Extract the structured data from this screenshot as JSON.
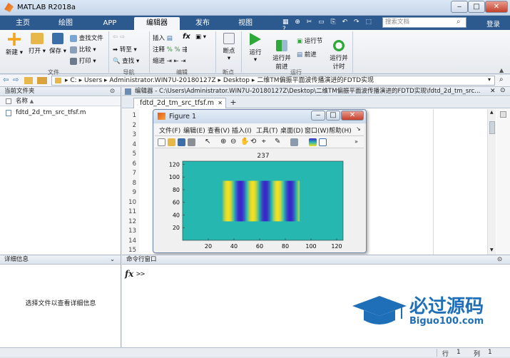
{
  "window": {
    "title": "MATLAB R2018a"
  },
  "tabs": [
    {
      "label": "主页",
      "active": false
    },
    {
      "label": "绘图",
      "active": false
    },
    {
      "label": "APP",
      "active": false
    },
    {
      "label": "编辑器",
      "active": true
    },
    {
      "label": "发布",
      "active": false
    },
    {
      "label": "视图",
      "active": false
    }
  ],
  "search": {
    "placeholder": "搜索文档",
    "login": "登录"
  },
  "toolstrip": {
    "file": {
      "new": "新建",
      "open": "打开",
      "save": "保存",
      "find_files": "查找文件",
      "compare": "比较",
      "print": "打印",
      "group": "文件"
    },
    "nav": {
      "goto": "转至",
      "find": "查找",
      "group": "导航"
    },
    "edit": {
      "insert": "插入",
      "comment": "注释",
      "indent": "缩进",
      "fx": "fx",
      "group": "编辑"
    },
    "breakpoints": {
      "label": "断点",
      "group": "断点"
    },
    "run": {
      "run": "运行",
      "run_advance": "运行并\n前进",
      "run_section": "运行节",
      "advance": "前进",
      "run_time": "运行并\n计时",
      "group": "运行"
    }
  },
  "address": {
    "parts": [
      "C:",
      "Users",
      "Administrator.WIN7U-20180127Z",
      "Desktop",
      "二维TM偏振平面波传播演进的FDTD实现"
    ]
  },
  "current_folder": {
    "title": "当前文件夹",
    "col_name": "名称",
    "col_sort": "▲",
    "files": [
      "fdtd_2d_tm_src_tfsf.m"
    ]
  },
  "details": {
    "title": "详细信息",
    "empty_msg": "选择文件以查看详细信息"
  },
  "editor": {
    "title": "编辑器 - C:\\Users\\Administrator.WIN7U-20180127Z\\Desktop\\二维TM偏振平面波传播演进的FDTD实现\\fdtd_2d_tm_src...",
    "tab": "fdtd_2d_tm_src_tfsf.m",
    "lines": [
      "1",
      "2",
      "3",
      "4",
      "5",
      "6",
      "7",
      "8",
      "9",
      "10",
      "11",
      "12",
      "13",
      "14",
      "15"
    ]
  },
  "command_window": {
    "title": "命令行窗口",
    "prompt": ">>"
  },
  "statusbar": {
    "row_label": "行",
    "row": "1",
    "col_label": "列",
    "col": "1"
  },
  "figure": {
    "title": "Figure 1",
    "menu": [
      "文件(F)",
      "编辑(E)",
      "查看(V)",
      "插入(I)",
      "工具(T)",
      "桌面(D)",
      "窗口(W)",
      "帮助(H)"
    ],
    "plot_title": "237",
    "xticks": [
      "20",
      "40",
      "60",
      "80",
      "100",
      "120"
    ],
    "yticks": [
      "120",
      "100",
      "80",
      "60",
      "40",
      "20"
    ],
    "colors": {
      "background": "#26b8b0",
      "blue": "#3b24c9",
      "yellow": "#f5e020"
    }
  },
  "watermark": {
    "cn": "必过源码",
    "en": "Biguo100.com"
  }
}
